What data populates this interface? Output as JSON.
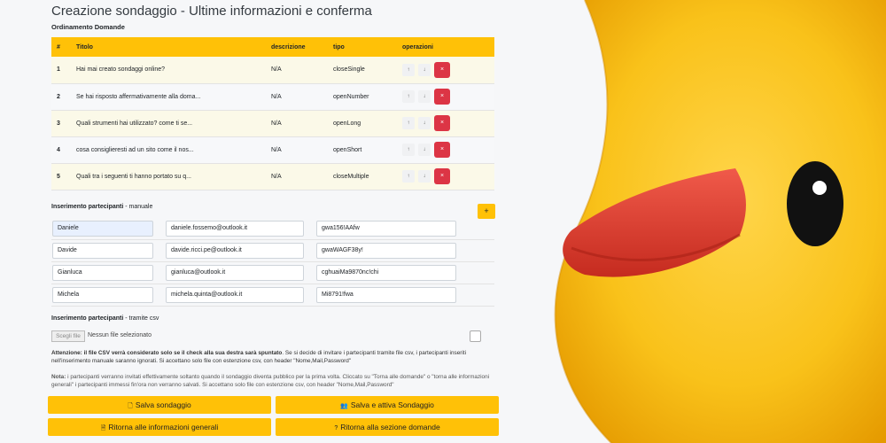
{
  "title": "Creazione sondaggio - Ultime informazioni e conferma",
  "ordering_label": "Ordinamento Domande",
  "table": {
    "headers": [
      "#",
      "Titolo",
      "descrizione",
      "tipo",
      "operazioni"
    ],
    "rows": [
      {
        "n": "1",
        "title": "Hai mai creato sondaggi online?",
        "desc": "N/A",
        "type": "closeSingle"
      },
      {
        "n": "2",
        "title": "Se hai risposto affermativamente alla doma...",
        "desc": "N/A",
        "type": "openNumber"
      },
      {
        "n": "3",
        "title": "Quali strumenti hai utilizzato? come ti se...",
        "desc": "N/A",
        "type": "openLong"
      },
      {
        "n": "4",
        "title": "cosa consiglieresti ad un sito come il nos...",
        "desc": "N/A",
        "type": "openShort"
      },
      {
        "n": "5",
        "title": "Quali tra i seguenti ti hanno portato su q...",
        "desc": "N/A",
        "type": "closeMultiple"
      }
    ],
    "up_symbol": "↑",
    "down_symbol": "↓",
    "delete_symbol": "×"
  },
  "manual": {
    "label_bold": "Inserimento partecipanti",
    "label_rest": " - manuale",
    "add_symbol": "+",
    "participants": [
      {
        "name": "Daniele",
        "email": "daniele.fossemo@outlook.it",
        "password": "gwa156!AAfw"
      },
      {
        "name": "Davide",
        "email": "davide.ricci.pe@outlook.it",
        "password": "gwaWAGF38y!"
      },
      {
        "name": "Gianluca",
        "email": "gianluca@outlook.it",
        "password": "cghuaiMa9870nc!chi"
      },
      {
        "name": "Michela",
        "email": "michela.quinta@outlook.it",
        "password": "Mi8791!fwa"
      }
    ]
  },
  "csv": {
    "label_bold": "Inserimento partecipanti",
    "label_rest": " - tramite csv",
    "file_button": "Scegli file",
    "file_status": "Nessun file selezionato"
  },
  "warning": {
    "bold": "Attenzione: il file CSV verrà considerato solo se il check alla sua destra sarà spuntato",
    "rest": ". Se si decide di invitare i partecipanti tramite file csv, i partecipanti inseriti nell'inserimento manuale saranno ignorati. Si accettano solo file con estenzione csv, con header \"Nome,Mail,Password\""
  },
  "note": {
    "bold": "Nota:",
    "rest": " i partecipanti verranno invitati effettivamente soltanto quando il sondaggio diventa pubblico per la prima volta. Cliccato su \"Torna alle domande\" o \"torna alle informazioni generali\" i partecipanti immessi fin'ora non verranno salvati. Si accettano solo file con estenzione csv, con header \"Nome,Mail,Password\""
  },
  "buttons": {
    "save": "Salva sondaggio",
    "save_activate": "Salva e attiva Sondaggio",
    "back_info": "Ritorna alle informazioni generali",
    "back_questions": "Ritorna alla sezione domande"
  },
  "colors": {
    "accent": "#ffc107",
    "danger": "#dc3545",
    "duck": "#f5b800",
    "beak": "#e0372b"
  }
}
